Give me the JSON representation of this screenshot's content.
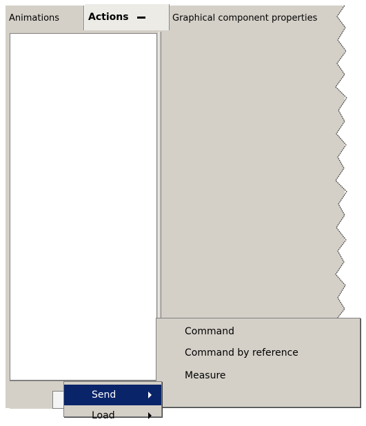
{
  "tabs": [
    {
      "label": "Animations",
      "active": false
    },
    {
      "label": "Actions",
      "active": true
    },
    {
      "label": "Graphical component properties",
      "active": false
    }
  ],
  "context_menu": {
    "items": [
      {
        "label": "Send",
        "highlighted": true,
        "has_submenu": true
      },
      {
        "label": "Load",
        "highlighted": false,
        "has_submenu": true
      }
    ]
  },
  "submenu": {
    "items": [
      {
        "label": "Command"
      },
      {
        "label": "Command by reference"
      },
      {
        "label": "Measure"
      }
    ]
  },
  "colors": {
    "highlight": "#0a246a",
    "panel": "#d4d0c8",
    "list_bg": "#ffffff"
  }
}
